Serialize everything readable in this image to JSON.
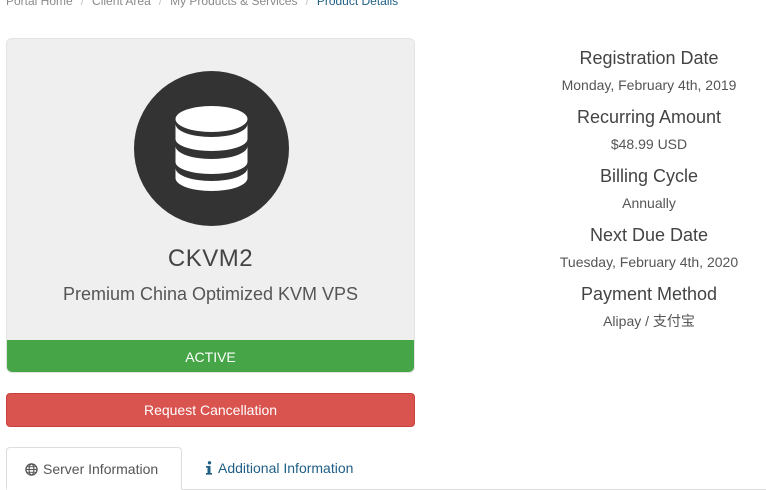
{
  "breadcrumb": [
    "Portal Home",
    "Client Area",
    "My Products & Services",
    "Product Details"
  ],
  "product": {
    "icon": "database-icon",
    "name": "CKVM2",
    "group": "Premium China Optimized KVM VPS",
    "status": "ACTIVE"
  },
  "actions": {
    "cancel": "Request Cancellation"
  },
  "tabs": [
    {
      "label": "Server Information",
      "icon": "globe-icon"
    },
    {
      "label": "Additional Information",
      "icon": "info-icon"
    }
  ],
  "details": [
    {
      "label": "Registration Date",
      "value": "Monday, February 4th, 2019"
    },
    {
      "label": "Recurring Amount",
      "value": "$48.99 USD"
    },
    {
      "label": "Billing Cycle",
      "value": "Annually"
    },
    {
      "label": "Next Due Date",
      "value": "Tuesday, February 4th, 2020"
    },
    {
      "label": "Payment Method",
      "value": "Alipay / 支付宝"
    }
  ],
  "colors": {
    "status": "#46a546",
    "danger": "#d9534f",
    "link": "#1f5f86",
    "card": "#efefef",
    "icon_circle": "#333333"
  }
}
